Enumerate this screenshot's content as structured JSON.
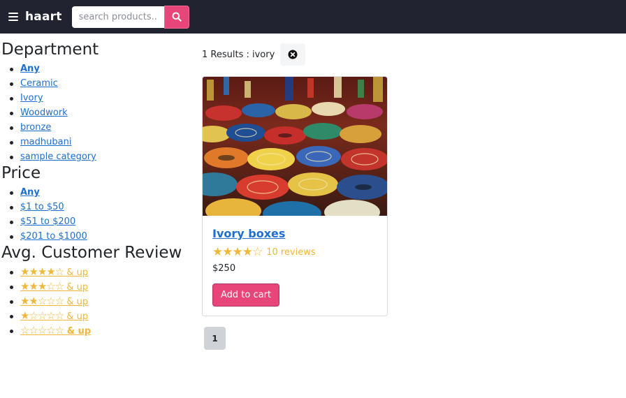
{
  "header": {
    "brand": "haart",
    "search_placeholder": "search products..."
  },
  "sidebar": {
    "department_title": "Department",
    "departments": [
      "Any",
      "Ceramic",
      "Ivory",
      "Woodwork",
      "bronze",
      "madhubani",
      "sample category"
    ],
    "price_title": "Price",
    "prices": [
      "Any",
      "$1 to $50",
      "$51 to $200",
      "$201 to $1000"
    ],
    "review_title": "Avg. Customer Review",
    "reviews": [
      {
        "stars": "★★★★☆",
        "label": " & up"
      },
      {
        "stars": "★★★☆☆",
        "label": " & up"
      },
      {
        "stars": "★★☆☆☆",
        "label": " & up"
      },
      {
        "stars": "★☆☆☆☆",
        "label": " & up"
      },
      {
        "stars": "☆☆☆☆☆",
        "label": " & up"
      }
    ]
  },
  "results": {
    "summary": "1 Results : ivory"
  },
  "product": {
    "name": "Ivory boxes",
    "stars": "★★★★☆",
    "rating": 4,
    "reviews": "10 reviews",
    "price": "$250",
    "cart_label": "Add to cart"
  },
  "pagination": {
    "current": "1"
  },
  "colors": {
    "header_bg": "#212430",
    "accent": "#e8457a",
    "link": "#1d6fd1",
    "star": "#f0b83a"
  }
}
